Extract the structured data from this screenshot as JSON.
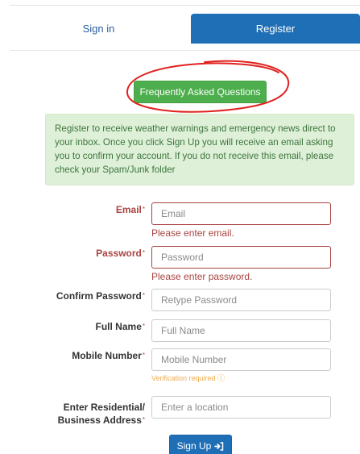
{
  "tabs": {
    "signin": "Sign in",
    "register": "Register"
  },
  "faq_button": "Frequently Asked Questions",
  "info_message": "Register to receive weather warnings and emergency news direct to your inbox. Once you click Sign Up you will receive an email asking you to confirm your account. If you do not receive this email, please check your Spam/Junk folder",
  "form": {
    "required_marker": "*",
    "email": {
      "label": "Email",
      "placeholder": "Email",
      "error": "Please enter email."
    },
    "password": {
      "label": "Password",
      "placeholder": "Password",
      "error": "Please enter password."
    },
    "confirm_password": {
      "label": "Confirm Password",
      "placeholder": "Retype Password"
    },
    "full_name": {
      "label": "Full Name",
      "placeholder": "Full Name"
    },
    "mobile": {
      "label": "Mobile Number",
      "placeholder": "Mobile Number",
      "hint": "Verification required",
      "hint_icon": "info-icon"
    },
    "address": {
      "label_line1": "Enter Residential/",
      "label_line2": "Business Address",
      "placeholder": "Enter a location"
    }
  },
  "signup_button": {
    "label": "Sign Up",
    "icon": "sign-in-icon"
  },
  "colors": {
    "primary": "#1f6fb6",
    "success": "#4cae4c",
    "error": "#a94442",
    "info_bg": "#dff0d8",
    "info_text": "#3c763d",
    "annotation": "#e0221f"
  }
}
